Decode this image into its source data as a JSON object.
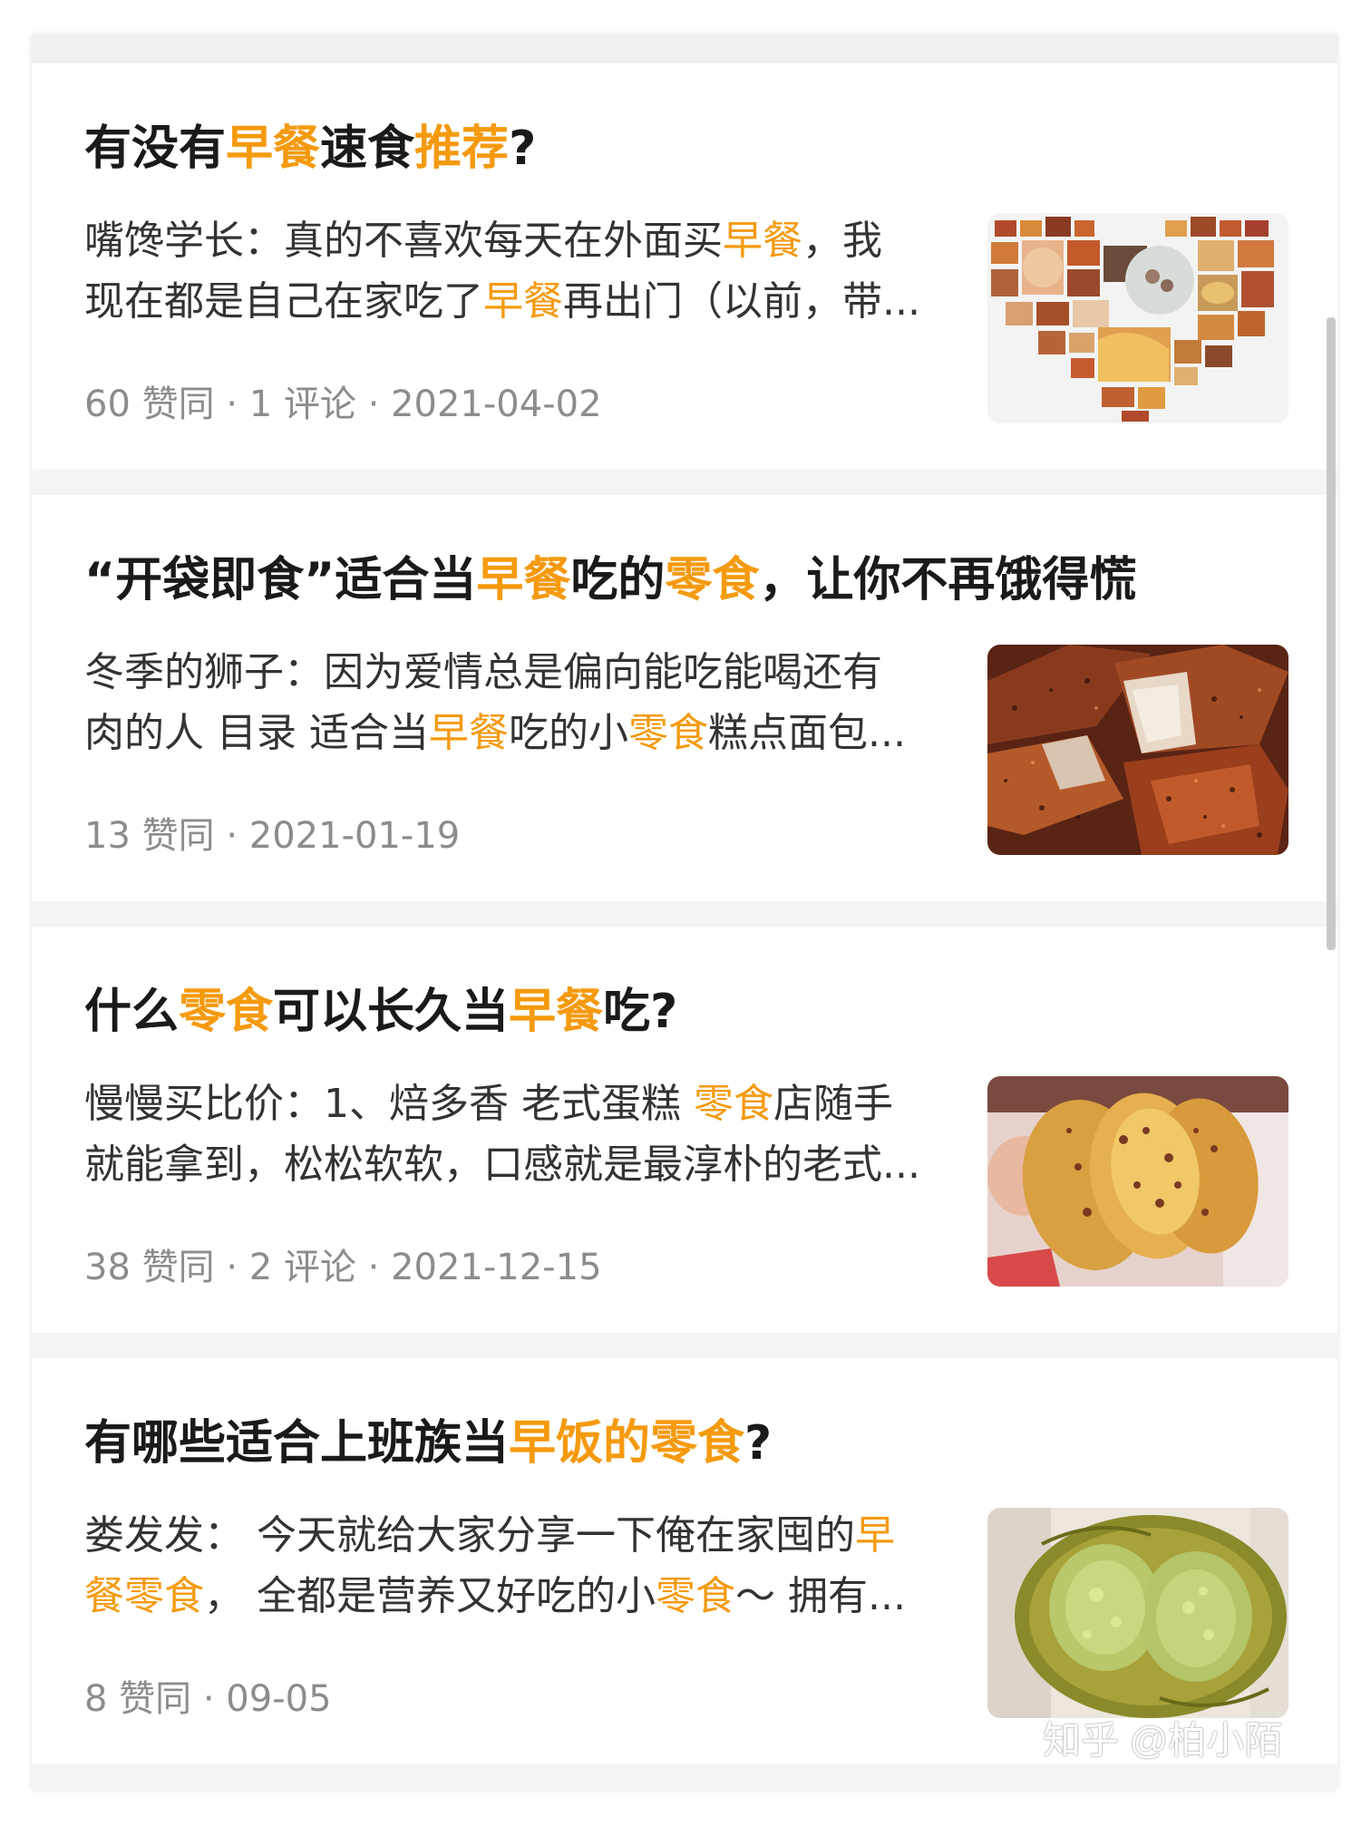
{
  "cards": [
    {
      "title": [
        {
          "t": "有没有",
          "h": false
        },
        {
          "t": "早餐",
          "h": true
        },
        {
          "t": "速食",
          "h": false
        },
        {
          "t": "推荐",
          "h": true
        },
        {
          "t": "?",
          "h": false
        }
      ],
      "excerpt_line1": [
        {
          "t": "嘴馋学长：真的不喜欢每天在外面买",
          "h": false
        },
        {
          "t": "早餐",
          "h": true
        },
        {
          "t": "，我",
          "h": false
        }
      ],
      "excerpt_line2": [
        {
          "t": "现在都是自己在家吃了",
          "h": false
        },
        {
          "t": "早餐",
          "h": true
        },
        {
          "t": "再出门（以前，带...",
          "h": false
        }
      ],
      "meta": "60 赞同 · 1 评论 · 2021-04-02",
      "thumbnail": "heart-food-collage-image"
    },
    {
      "title": [
        {
          "t": "“开袋即食”适合当",
          "h": false
        },
        {
          "t": "早餐",
          "h": true
        },
        {
          "t": "吃的",
          "h": false
        },
        {
          "t": "零食",
          "h": true
        },
        {
          "t": "，让你不再饿得慌",
          "h": false
        }
      ],
      "excerpt_line1": [
        {
          "t": "冬季的狮子：因为爱情总是偏向能吃能喝还有",
          "h": false
        }
      ],
      "excerpt_line2": [
        {
          "t": "肉的人 目录 适合当",
          "h": false
        },
        {
          "t": "早餐",
          "h": true
        },
        {
          "t": "吃的小",
          "h": false
        },
        {
          "t": "零食",
          "h": true
        },
        {
          "t": "糕点面包...",
          "h": false
        }
      ],
      "meta": "13 赞同 · 2021-01-19",
      "thumbnail": "spicy-fried-snack-image"
    },
    {
      "title": [
        {
          "t": "什么",
          "h": false
        },
        {
          "t": "零食",
          "h": true
        },
        {
          "t": "可以长久当",
          "h": false
        },
        {
          "t": "早餐",
          "h": true
        },
        {
          "t": "吃?",
          "h": false
        }
      ],
      "excerpt_line1": [
        {
          "t": "慢慢买比价：1、焙多香 老式蛋糕 ",
          "h": false
        },
        {
          "t": "零食",
          "h": true
        },
        {
          "t": "店随手",
          "h": false
        }
      ],
      "excerpt_line2": [
        {
          "t": "就能拿到，松松软软，口感就是最淳朴的老式...",
          "h": false
        }
      ],
      "meta": "38 赞同 · 2 评论 · 2021-12-15",
      "thumbnail": "old-style-cake-image"
    },
    {
      "title": [
        {
          "t": "有哪些适合上班族当",
          "h": false
        },
        {
          "t": "早饭的零食",
          "h": true
        },
        {
          "t": "?",
          "h": false
        }
      ],
      "excerpt_line1": [
        {
          "t": "娄发发： 今天就给大家分享一下俺在家囤的",
          "h": false
        },
        {
          "t": "早",
          "h": true
        }
      ],
      "excerpt_line2": [
        {
          "t": "餐零食",
          "h": true
        },
        {
          "t": "， 全都是营养又好吃的小",
          "h": false
        },
        {
          "t": "零食",
          "h": true
        },
        {
          "t": "～ 拥有...",
          "h": false
        }
      ],
      "meta": "8 赞同 · 09-05",
      "thumbnail": "green-pastry-image"
    }
  ],
  "watermark": "知乎 @柏小陌",
  "colors": {
    "highlight": "#f59a0f",
    "title": "#1a1a1a",
    "body": "#333333",
    "meta": "#8c8c8c",
    "separator": "#f4f4f4"
  }
}
